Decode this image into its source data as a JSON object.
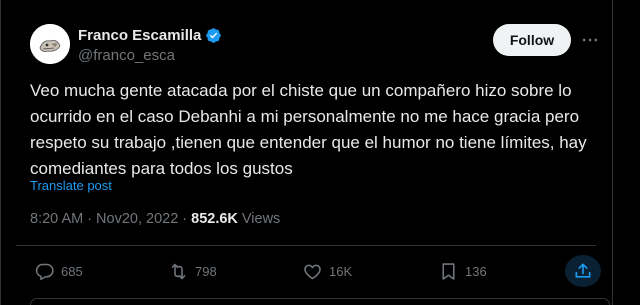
{
  "author": {
    "display_name": "Franco Escamilla",
    "handle": "@franco_esca",
    "verified": true
  },
  "follow_label": "Follow",
  "post": {
    "text": "Veo mucha gente atacada por el chiste que un compañero hizo sobre lo ocurrido en el caso Debanhi a mi personalmente no me hace gracia pero respeto su trabajo ,tienen que entender que el humor no tiene límites, hay comediantes para todos los gustos",
    "translate_label": "Translate post"
  },
  "meta": {
    "time": "8:20 AM",
    "date": "Nov20, 2022",
    "views_count": "852.6K",
    "views_label": "Views"
  },
  "actions": {
    "replies": "685",
    "reposts": "798",
    "likes": "16K",
    "bookmarks": "136"
  },
  "colors": {
    "background": "#000000",
    "accent": "#1d9bf0",
    "muted": "#71767b",
    "text": "#e7e9ea"
  },
  "icons": [
    "verified-icon",
    "more-icon",
    "reply-icon",
    "repost-icon",
    "like-icon",
    "bookmark-icon",
    "share-icon"
  ]
}
